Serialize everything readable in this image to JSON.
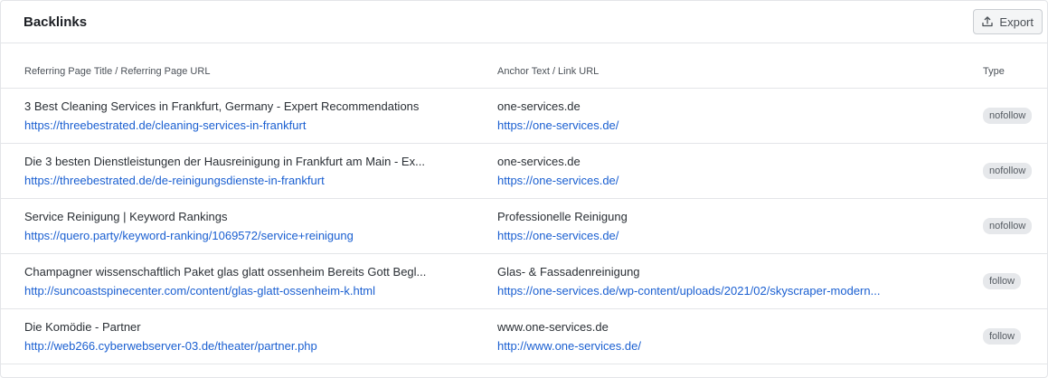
{
  "header": {
    "title": "Backlinks",
    "export_label": "Export"
  },
  "columns": {
    "referring": "Referring Page Title / Referring Page URL",
    "anchor": "Anchor Text / Link URL",
    "type": "Type"
  },
  "rows": [
    {
      "title": "3 Best Cleaning Services in Frankfurt, Germany - Expert Recommendations",
      "url": "https://threebestrated.de/cleaning-services-in-frankfurt",
      "anchor": "one-services.de",
      "link_url": "https://one-services.de/",
      "type": "nofollow"
    },
    {
      "title": "Die 3 besten Dienstleistungen der Hausreinigung in Frankfurt am Main - Ex...",
      "url": "https://threebestrated.de/de-reinigungsdienste-in-frankfurt",
      "anchor": "one-services.de",
      "link_url": "https://one-services.de/",
      "type": "nofollow"
    },
    {
      "title": "Service Reinigung | Keyword Rankings",
      "url": "https://quero.party/keyword-ranking/1069572/service+reinigung",
      "anchor": "Professionelle Reinigung",
      "link_url": "https://one-services.de/",
      "type": "nofollow"
    },
    {
      "title": "Champagner wissenschaftlich Paket glas glatt ossenheim Bereits Gott Begl...",
      "url": "http://suncoastspinecenter.com/content/glas-glatt-ossenheim-k.html",
      "anchor": "Glas- & Fassadenreinigung",
      "link_url": "https://one-services.de/wp-content/uploads/2021/02/skyscraper-modern...",
      "type": "follow"
    },
    {
      "title": "Die Komödie - Partner",
      "url": "http://web266.cyberwebserver-03.de/theater/partner.php",
      "anchor": "www.one-services.de",
      "link_url": "http://www.one-services.de/",
      "type": "follow"
    }
  ]
}
